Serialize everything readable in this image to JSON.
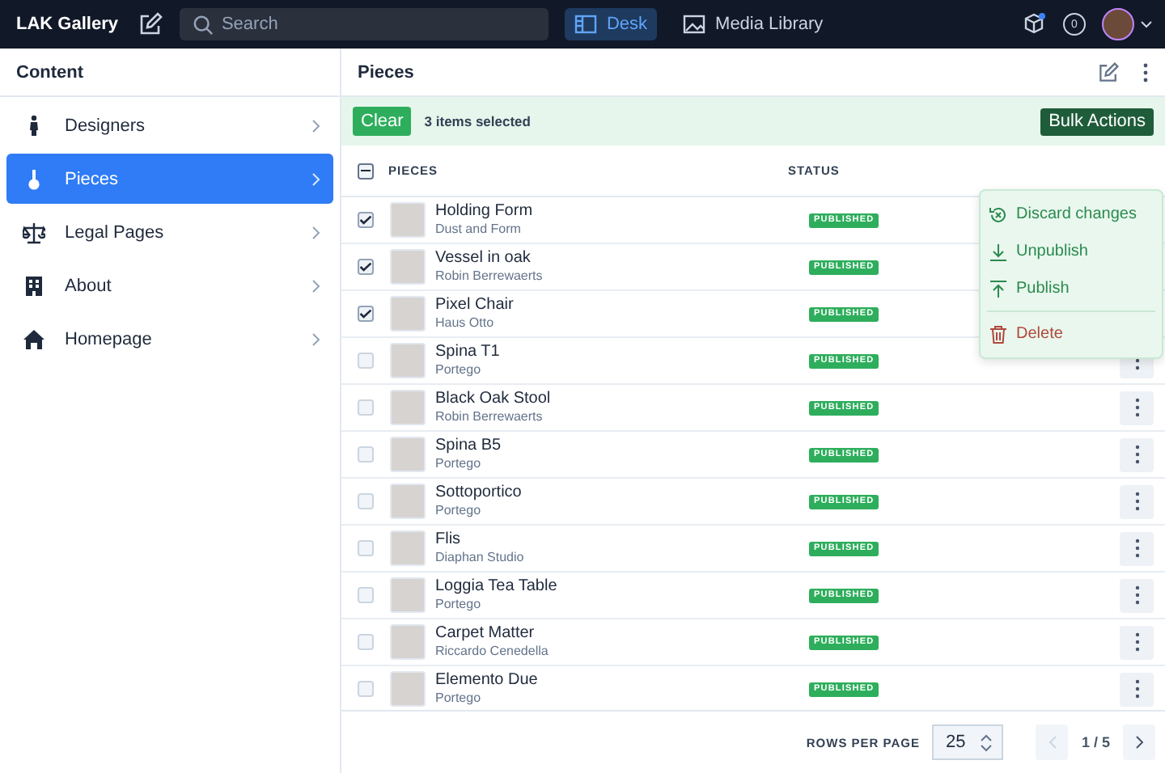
{
  "topbar": {
    "brand": "LAK Gallery",
    "search": {
      "placeholder": "Search"
    },
    "nav": [
      {
        "label": "Desk",
        "selected": true
      },
      {
        "label": "Media Library",
        "selected": false
      }
    ],
    "notifications": "0"
  },
  "sidebar": {
    "title": "Content",
    "items": [
      {
        "label": "Designers",
        "selected": false
      },
      {
        "label": "Pieces",
        "selected": true
      },
      {
        "label": "Legal Pages",
        "selected": false
      },
      {
        "label": "About",
        "selected": false
      },
      {
        "label": "Homepage",
        "selected": false
      }
    ]
  },
  "pane": {
    "title": "Pieces"
  },
  "bulk_bar": {
    "clear": "Clear",
    "count": "3 items selected",
    "bulk_actions": "Bulk Actions"
  },
  "bulk_menu": [
    {
      "label": "Discard changes",
      "kind": "discard"
    },
    {
      "label": "Unpublish",
      "kind": "unpublish"
    },
    {
      "label": "Publish",
      "kind": "publish"
    },
    {
      "label": "Delete",
      "kind": "delete"
    }
  ],
  "table": {
    "select_all": {
      "indeterminate": true
    },
    "columns": [
      "PIECES",
      "STATUS"
    ],
    "rows": [
      {
        "title": "Holding Form",
        "subtitle": "Dust and Form",
        "status": "PUBLISHED",
        "checked": true
      },
      {
        "title": "Vessel in oak",
        "subtitle": "Robin Berrewaerts",
        "status": "PUBLISHED",
        "checked": true
      },
      {
        "title": "Pixel Chair",
        "subtitle": "Haus Otto",
        "status": "PUBLISHED",
        "checked": true
      },
      {
        "title": "Spina T1",
        "subtitle": "Portego",
        "status": "PUBLISHED",
        "checked": false
      },
      {
        "title": "Black Oak Stool",
        "subtitle": "Robin Berrewaerts",
        "status": "PUBLISHED",
        "checked": false
      },
      {
        "title": "Spina B5",
        "subtitle": "Portego",
        "status": "PUBLISHED",
        "checked": false
      },
      {
        "title": "Sottoportico",
        "subtitle": "Portego",
        "status": "PUBLISHED",
        "checked": false
      },
      {
        "title": "Flis",
        "subtitle": "Diaphan Studio",
        "status": "PUBLISHED",
        "checked": false
      },
      {
        "title": "Loggia Tea Table",
        "subtitle": "Portego",
        "status": "PUBLISHED",
        "checked": false
      },
      {
        "title": "Carpet Matter",
        "subtitle": "Riccardo Cenedella",
        "status": "PUBLISHED",
        "checked": false
      },
      {
        "title": "Elemento Due",
        "subtitle": "Portego",
        "status": "PUBLISHED",
        "checked": false
      }
    ]
  },
  "footer": {
    "rows_per_page_label": "ROWS PER PAGE",
    "rows_per_page": "25",
    "page": "1 / 5"
  }
}
